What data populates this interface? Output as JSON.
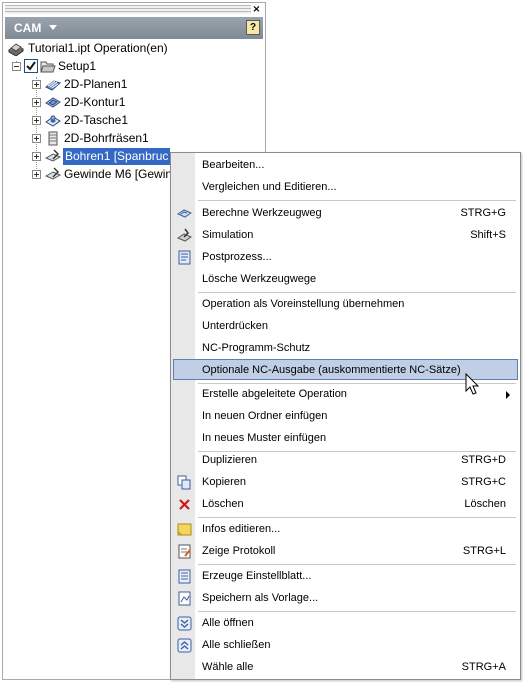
{
  "panel": {
    "close_glyph": "×",
    "header_title": "CAM",
    "help_glyph": "?"
  },
  "tree": {
    "root": "Tutorial1.ipt Operation(en)",
    "setup": "Setup1",
    "operations": [
      "2D-Planen1",
      "2D-Kontur1",
      "2D-Tasche1",
      "2D-Bohrfräsen1",
      "Bohren1 [Spanbruc",
      "Gewinde M6 [Gewin"
    ]
  },
  "menu": {
    "items": [
      {
        "label": "Bearbeiten...",
        "shortcut": "",
        "icon": ""
      },
      {
        "label": "Vergleichen und Editieren...",
        "shortcut": "",
        "icon": ""
      },
      {
        "label": "Berechne Werkzeugweg",
        "shortcut": "STRG+G",
        "icon": "generate-toolpath-icon"
      },
      {
        "label": "Simulation",
        "shortcut": "Shift+S",
        "icon": "simulation-icon"
      },
      {
        "label": "Postprozess...",
        "shortcut": "",
        "icon": "post-process-icon"
      },
      {
        "label": "Lösche Werkzeugwege",
        "shortcut": "",
        "icon": ""
      },
      {
        "label": "Operation als Voreinstellung übernehmen",
        "shortcut": "",
        "icon": ""
      },
      {
        "label": "Unterdrücken",
        "shortcut": "",
        "icon": ""
      },
      {
        "label": "NC-Programm-Schutz",
        "shortcut": "",
        "icon": ""
      },
      {
        "label": "Optionale NC-Ausgabe (auskommentierte NC-Sätze)",
        "shortcut": "",
        "icon": ""
      },
      {
        "label": "Erstelle abgeleitete Operation",
        "shortcut": "",
        "icon": ""
      },
      {
        "label": "In neuen Ordner einfügen",
        "shortcut": "",
        "icon": ""
      },
      {
        "label": "In neues Muster einfügen",
        "shortcut": "",
        "icon": ""
      },
      {
        "label": "Duplizieren",
        "shortcut": "STRG+D",
        "icon": ""
      },
      {
        "label": "Kopieren",
        "shortcut": "STRG+C",
        "icon": "copy-icon"
      },
      {
        "label": "Löschen",
        "shortcut": "Löschen",
        "icon": "delete-icon"
      },
      {
        "label": "Infos editieren...",
        "shortcut": "",
        "icon": "notes-icon"
      },
      {
        "label": "Zeige Protokoll",
        "shortcut": "STRG+L",
        "icon": "log-icon"
      },
      {
        "label": "Erzeuge Einstellblatt...",
        "shortcut": "",
        "icon": "setup-sheet-icon"
      },
      {
        "label": "Speichern als Vorlage...",
        "shortcut": "",
        "icon": "template-icon"
      },
      {
        "label": "Alle öffnen",
        "shortcut": "",
        "icon": "expand-all-icon"
      },
      {
        "label": "Alle schließen",
        "shortcut": "",
        "icon": "collapse-all-icon"
      },
      {
        "label": "Wähle alle",
        "shortcut": "STRG+A",
        "icon": ""
      }
    ]
  },
  "colors": {
    "header": "#8a949e",
    "selection": "#3568c4",
    "menu_highlight": "#c0cfe5"
  }
}
